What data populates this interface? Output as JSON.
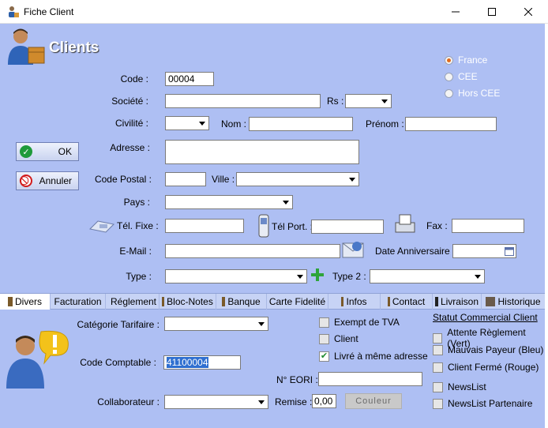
{
  "window": {
    "title": "Fiche Client",
    "min_icon": "minimize-icon",
    "max_icon": "maximize-icon",
    "close_icon": "close-icon"
  },
  "header": {
    "title": "Clients"
  },
  "zone": {
    "options": [
      "France",
      "CEE",
      "Hors CEE"
    ],
    "selected": "France"
  },
  "buttons": {
    "ok": "OK",
    "cancel": "Annuler"
  },
  "form": {
    "code_label": "Code :",
    "code_value": "00004",
    "societe_label": "Société :",
    "rs_label": "Rs :",
    "civilite_label": "Civilité :",
    "nom_label": "Nom :",
    "prenom_label": "Prénom :",
    "adresse_label": "Adresse :",
    "cp_label": "Code Postal :",
    "ville_label": "Ville :",
    "pays_label": "Pays :",
    "tel_fixe_label": "Tél. Fixe :",
    "tel_port_label": "Tél Port. :",
    "fax_label": "Fax :",
    "email_label": "E-Mail :",
    "anniv_label": "Date Anniversaire :",
    "type_label": "Type :",
    "type2_label": "Type 2 :"
  },
  "tabs": [
    "Divers",
    "Facturation",
    "Réglement",
    "Bloc-Notes",
    "Banque",
    "Carte Fidelité",
    "Infos",
    "Contact",
    "Livraison",
    "Historique"
  ],
  "active_tab": "Divers",
  "divers": {
    "categorie_label": "Catégorie Tarifaire :",
    "code_comptable_label": "Code Comptable :",
    "code_comptable_value": "41100004",
    "eori_label": "N° EORI :",
    "collaborateur_label": "Collaborateur :",
    "remise_label": "Remise :",
    "remise_value": "0,00",
    "couleur_label": "Couleur",
    "checks": [
      {
        "label": "Exempt de TVA",
        "checked": false
      },
      {
        "label": "Client",
        "checked": false
      },
      {
        "label": "Livré à même adresse",
        "checked": true
      }
    ],
    "statut_title": "Statut Commercial Client",
    "statut": [
      {
        "label": "Attente Règlement (Vert)",
        "checked": false
      },
      {
        "label": "Mauvais Payeur (Bleu)",
        "checked": false
      },
      {
        "label": "Client Fermé (Rouge)",
        "checked": false
      },
      {
        "label": "NewsList",
        "checked": false
      },
      {
        "label": "NewsList Partenaire",
        "checked": false
      }
    ]
  },
  "colors": {
    "panel": "#aebff3",
    "tabbar": "#c7d3f5",
    "radio_selected": "#e06a1c"
  }
}
